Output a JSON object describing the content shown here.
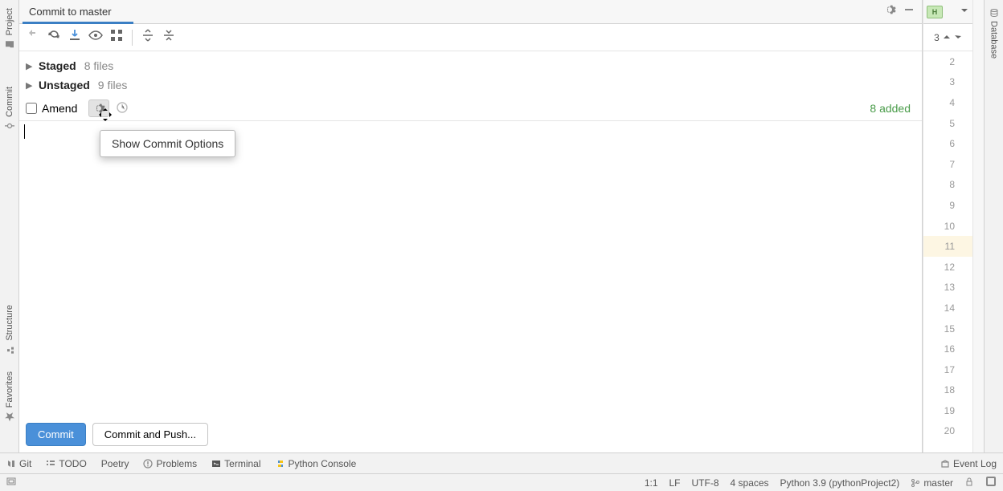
{
  "left_rail": {
    "project": "Project",
    "commit": "Commit",
    "structure": "Structure",
    "favorites": "Favorites"
  },
  "right_rail": {
    "database": "Database"
  },
  "panel": {
    "title": "Commit to master"
  },
  "changes": {
    "staged_label": "Staged",
    "staged_count": "8 files",
    "unstaged_label": "Unstaged",
    "unstaged_count": "9 files"
  },
  "amend": {
    "label": "Amend",
    "added": "8 added"
  },
  "tooltip": {
    "text": "Show Commit Options"
  },
  "buttons": {
    "commit": "Commit",
    "commit_push": "Commit and Push..."
  },
  "gutter": {
    "search_badge": "3",
    "hbadge": "H",
    "lines": [
      "2",
      "3",
      "4",
      "5",
      "6",
      "7",
      "8",
      "9",
      "10",
      "11",
      "12",
      "13",
      "14",
      "15",
      "16",
      "17",
      "18",
      "19",
      "20"
    ],
    "highlight": "11"
  },
  "bottom_tabs": {
    "git": "Git",
    "todo": "TODO",
    "poetry": "Poetry",
    "problems": "Problems",
    "terminal": "Terminal",
    "python_console": "Python Console",
    "event_log": "Event Log"
  },
  "status": {
    "pos": "1:1",
    "lf": "LF",
    "enc": "UTF-8",
    "indent": "4 spaces",
    "sdk": "Python 3.9 (pythonProject2)",
    "branch": "master"
  }
}
